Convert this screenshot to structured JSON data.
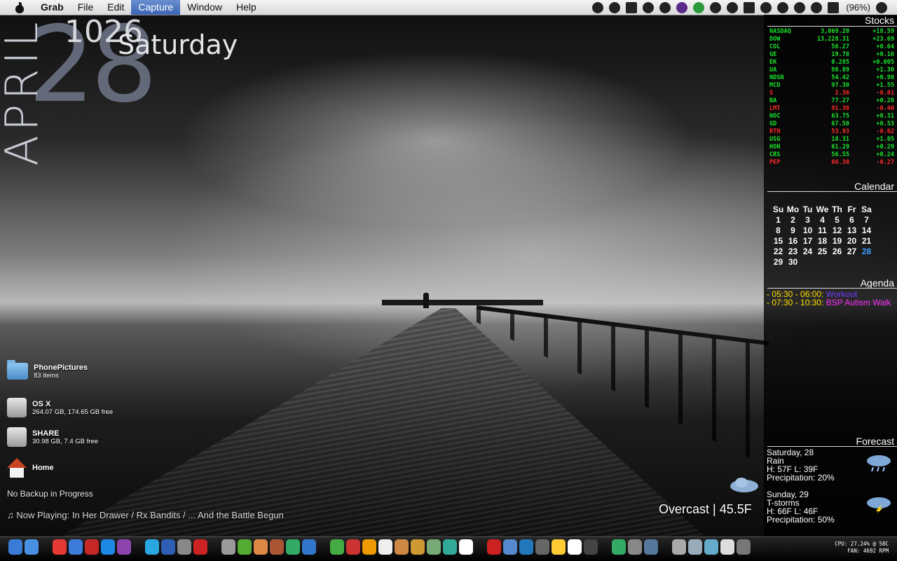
{
  "menubar": {
    "app": "Grab",
    "items": [
      "File",
      "Edit",
      "Capture",
      "Window",
      "Help"
    ],
    "active": "Capture",
    "battery": "(96%)"
  },
  "date_widget": {
    "month": "APRIL",
    "day": "28",
    "time": "1026",
    "weekday": "Saturday"
  },
  "stocks": {
    "title": "Stocks",
    "rows": [
      {
        "symbol": "NASDAQ",
        "price": "3,069.20",
        "change": "+18.59",
        "dir": "up"
      },
      {
        "symbol": "DOW",
        "price": "13,228.31",
        "change": "+23.69",
        "dir": "up"
      },
      {
        "symbol": "COL",
        "price": "56.27",
        "change": "+0.64",
        "dir": "up"
      },
      {
        "symbol": "GE",
        "price": "19.78",
        "change": "+0.16",
        "dir": "up"
      },
      {
        "symbol": "EK",
        "price": "0.285",
        "change": "+0.005",
        "dir": "up"
      },
      {
        "symbol": "UA",
        "price": "98.89",
        "change": "+1.30",
        "dir": "up"
      },
      {
        "symbol": "NDSN",
        "price": "54.42",
        "change": "+0.98",
        "dir": "up"
      },
      {
        "symbol": "MCD",
        "price": "97.30",
        "change": "+1.55",
        "dir": "up"
      },
      {
        "symbol": "S",
        "price": "2.36",
        "change": "-0.01",
        "dir": "down"
      },
      {
        "symbol": "BA",
        "price": "77.27",
        "change": "+0.28",
        "dir": "up"
      },
      {
        "symbol": "LMT",
        "price": "91.30",
        "change": "-0.40",
        "dir": "down"
      },
      {
        "symbol": "NOC",
        "price": "63.75",
        "change": "+0.31",
        "dir": "up"
      },
      {
        "symbol": "GD",
        "price": "67.50",
        "change": "+0.53",
        "dir": "up"
      },
      {
        "symbol": "RTN",
        "price": "53.93",
        "change": "-0.02",
        "dir": "down"
      },
      {
        "symbol": "USG",
        "price": "18.31",
        "change": "+1.05",
        "dir": "up"
      },
      {
        "symbol": "HON",
        "price": "61.29",
        "change": "+0.29",
        "dir": "up"
      },
      {
        "symbol": "CRS",
        "price": "56.55",
        "change": "+0.24",
        "dir": "up"
      },
      {
        "symbol": "PEP",
        "price": "66.30",
        "change": "-0.27",
        "dir": "down"
      }
    ]
  },
  "calendar": {
    "title": "Calendar",
    "headers": [
      "Su",
      "Mo",
      "Tu",
      "We",
      "Th",
      "Fr",
      "Sa"
    ],
    "weeks": [
      [
        "1",
        "2",
        "3",
        "4",
        "5",
        "6",
        "7"
      ],
      [
        "8",
        "9",
        "10",
        "11",
        "12",
        "13",
        "14"
      ],
      [
        "15",
        "16",
        "17",
        "18",
        "19",
        "20",
        "21"
      ],
      [
        "22",
        "23",
        "24",
        "25",
        "26",
        "27",
        "28"
      ],
      [
        "29",
        "30",
        "",
        "",
        "",
        "",
        ""
      ]
    ],
    "today": "28"
  },
  "agenda": {
    "title": "Agenda",
    "events": [
      {
        "time": "- 05:30 - 06:00:",
        "title": "Workout",
        "color": "#7040ff"
      },
      {
        "time": "- 07:30 - 10:30:",
        "title": "BSP Autism Walk",
        "color": "#ff30ff"
      }
    ]
  },
  "forecast": {
    "title": "Forecast",
    "days": [
      {
        "day": "Saturday, 28",
        "cond": "Rain",
        "hl": "H: 57F L: 39F",
        "precip": "Precipitation: 20%",
        "icon": "rain-cloud-icon"
      },
      {
        "day": "Sunday, 29",
        "cond": "T-storms",
        "hl": "H: 66F L: 46F",
        "precip": "Precipitation: 50%",
        "icon": "storm-cloud-icon"
      }
    ]
  },
  "desktop": [
    {
      "name": "PhonePictures",
      "sub": "83 items",
      "icon": "folder-icon"
    },
    {
      "name": "OS X",
      "sub": "264.07 GB, 174.65 GB free",
      "icon": "disk-icon"
    },
    {
      "name": "SHARE",
      "sub": "30.98 GB, 7.4 GB free",
      "icon": "disk-icon"
    },
    {
      "name": "Home",
      "sub": "",
      "icon": "home-icon"
    }
  ],
  "status": {
    "backup": "No Backup in Progress",
    "now_playing": "♫ Now Playing: In Her Drawer / Rx Bandits / ... And the Battle Begun",
    "weather_now": "Overcast | 45.5F"
  },
  "system_stats": {
    "cpu": "CPU: 27.24% @ 58C",
    "fan": "FAN: 4692 RPM"
  },
  "dock": {
    "colors": [
      "#3a7bd5",
      "#4a90e2",
      "#e53935",
      "#3d7bd8",
      "#c62828",
      "#1e88e5",
      "#8e44ad",
      "#2aa6e0",
      "#2e5fb5",
      "#888",
      "#cc2222",
      "#9a9a9a",
      "#5a3",
      "#d84",
      "#aa5533",
      "#3a6",
      "#37c",
      "#4a4",
      "#c33",
      "#e90",
      "#eee",
      "#c84",
      "#c93",
      "#7a7",
      "#3a9",
      "#fff",
      "#c22",
      "#58c",
      "#27b",
      "#666",
      "#fc3",
      "#fff",
      "#444",
      "#3a6",
      "#888",
      "#579",
      "#aaa",
      "#9ab",
      "#6ac",
      "#ddd",
      "#777"
    ]
  }
}
